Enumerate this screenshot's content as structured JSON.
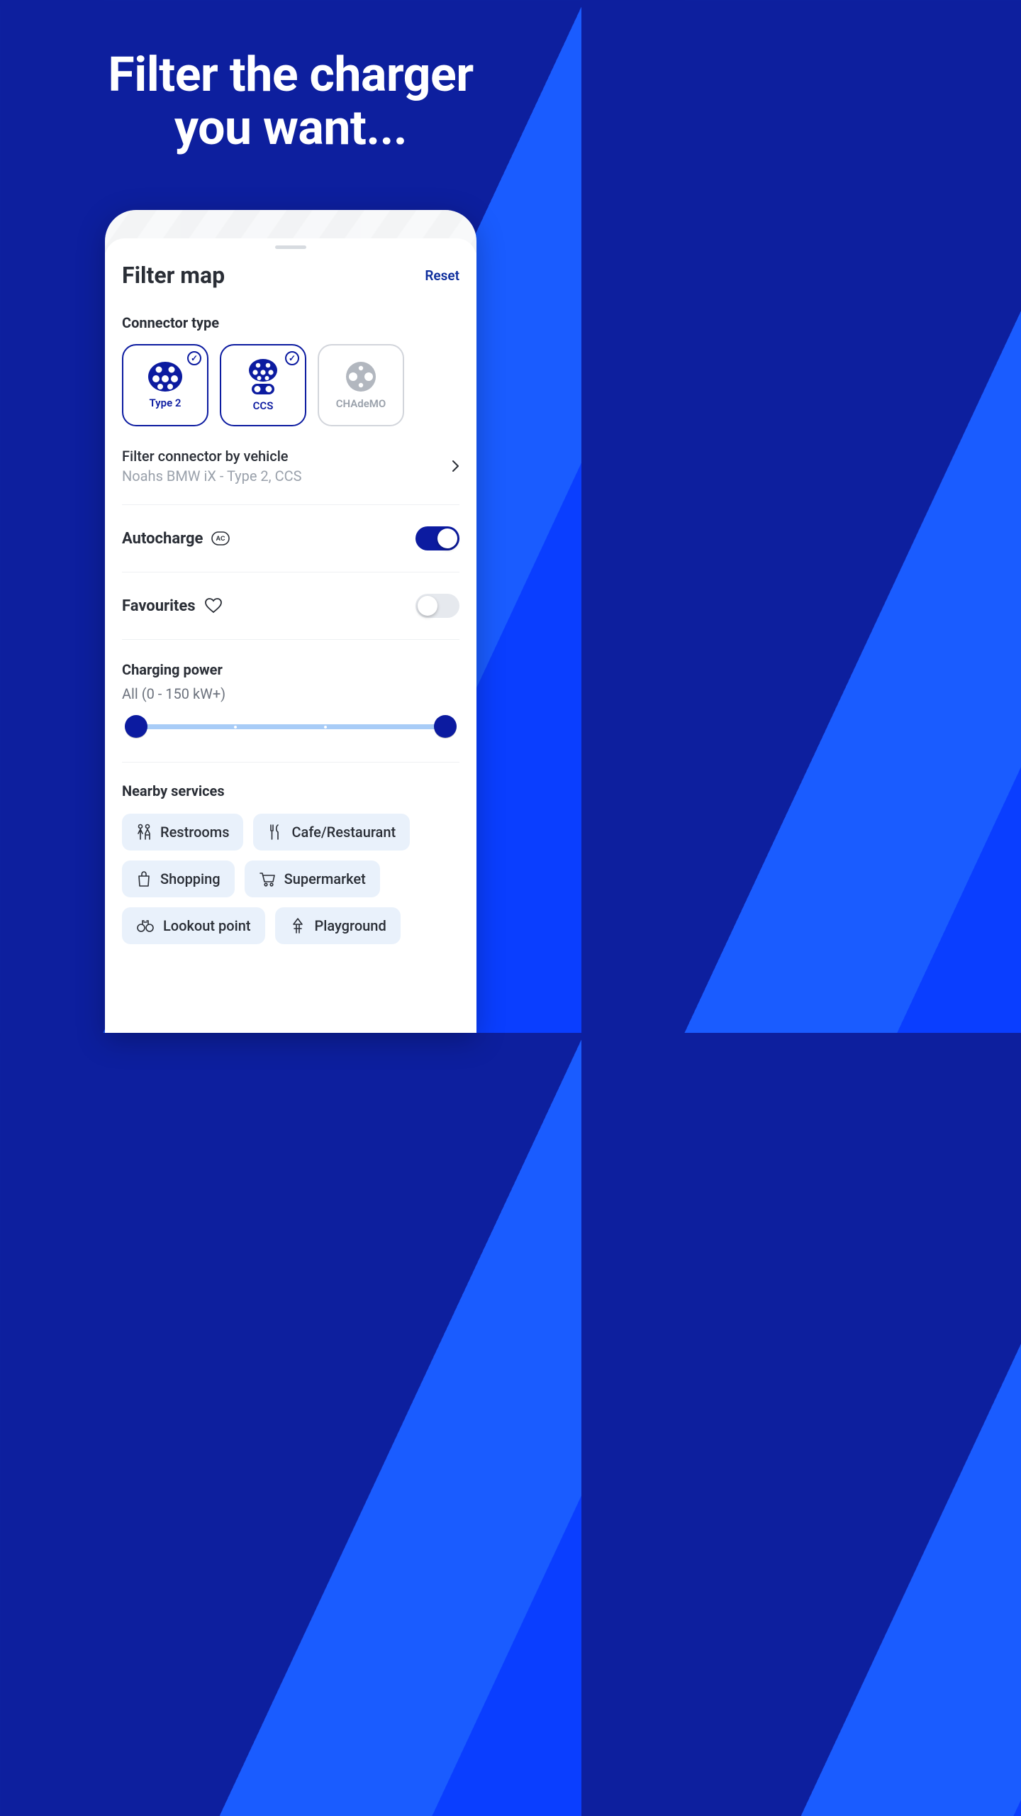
{
  "hero": {
    "line1": "Filter the charger",
    "line2": "you want..."
  },
  "sheet": {
    "title": "Filter map",
    "reset": "Reset"
  },
  "connector_section": {
    "title": "Connector type",
    "items": [
      {
        "label": "Type 2",
        "selected": true
      },
      {
        "label": "CCS",
        "selected": true
      },
      {
        "label": "CHAdeMO",
        "selected": false
      }
    ]
  },
  "vehicle_filter": {
    "title": "Filter connector by vehicle",
    "subtitle": "Noahs BMW iX - Type 2, CCS"
  },
  "toggles": {
    "autocharge_label": "Autocharge",
    "autocharge_on": true,
    "favourites_label": "Favourites",
    "favourites_on": false
  },
  "power": {
    "title": "Charging power",
    "value": "All (0 - 150 kW+)"
  },
  "services_section": {
    "title": "Nearby services",
    "items": [
      "Restrooms",
      "Cafe/Restaurant",
      "Shopping",
      "Supermarket",
      "Lookout point",
      "Playground"
    ]
  }
}
